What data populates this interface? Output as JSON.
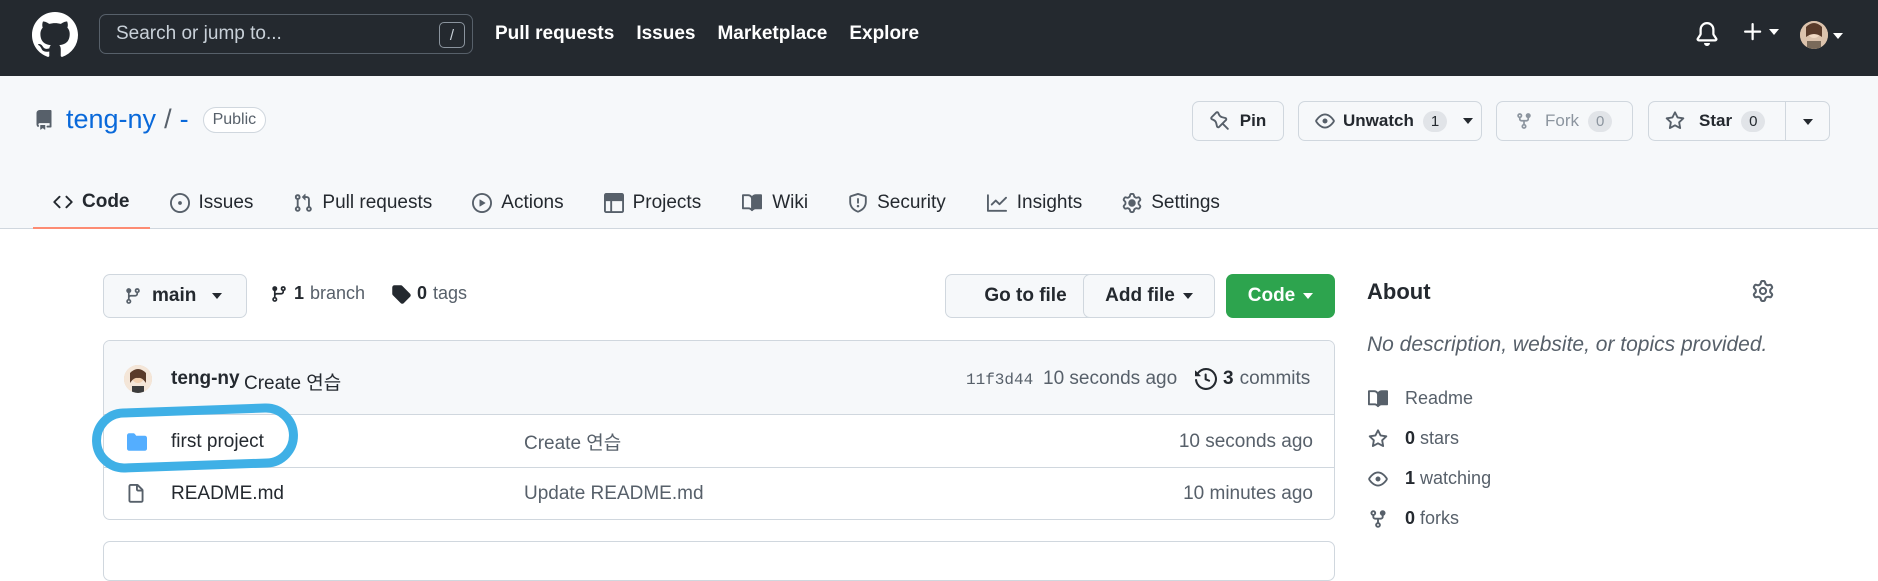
{
  "header": {
    "search_placeholder": "Search or jump to...",
    "slash_key": "/",
    "nav": [
      "Pull requests",
      "Issues",
      "Marketplace",
      "Explore"
    ]
  },
  "repo": {
    "owner": "teng-ny",
    "separator": "/",
    "name": "-",
    "visibility": "Public",
    "pin_label": "Pin",
    "unwatch_label": "Unwatch",
    "watch_count": "1",
    "fork_label": "Fork",
    "fork_count": "0",
    "star_label": "Star",
    "star_count": "0"
  },
  "tabs": [
    {
      "label": "Code",
      "icon": "code-icon"
    },
    {
      "label": "Issues",
      "icon": "issue-icon"
    },
    {
      "label": "Pull requests",
      "icon": "pull-request-icon"
    },
    {
      "label": "Actions",
      "icon": "play-icon"
    },
    {
      "label": "Projects",
      "icon": "table-icon"
    },
    {
      "label": "Wiki",
      "icon": "book-icon"
    },
    {
      "label": "Security",
      "icon": "shield-icon"
    },
    {
      "label": "Insights",
      "icon": "graph-icon"
    },
    {
      "label": "Settings",
      "icon": "gear-icon"
    }
  ],
  "toolbar": {
    "branch": "main",
    "branch_count": "1",
    "branch_label": "branch",
    "tag_count": "0",
    "tag_label": "tags",
    "go_to_file": "Go to file",
    "add_file": "Add file",
    "code": "Code"
  },
  "commit": {
    "author": "teng-ny",
    "message": "Create 연습",
    "sha": "11f3d44",
    "time": "10 seconds ago",
    "count": "3",
    "count_label": "commits"
  },
  "files": [
    {
      "name": "first project",
      "type": "folder",
      "message": "Create 연습",
      "time": "10 seconds ago"
    },
    {
      "name": "README.md",
      "type": "file",
      "message": "Update README.md",
      "time": "10 minutes ago"
    }
  ],
  "about": {
    "title": "About",
    "description": "No description, website, or topics provided.",
    "readme": "Readme",
    "stars_count": "0",
    "stars_label": "stars",
    "watching_count": "1",
    "watching_label": "watching",
    "forks_count": "0",
    "forks_label": "forks"
  },
  "colors": {
    "header_bg": "#24292f",
    "link": "#0969da",
    "code_button": "#2da44e",
    "active_tab_underline": "#fd8c73",
    "highlight_circle": "#3fb0e6"
  }
}
